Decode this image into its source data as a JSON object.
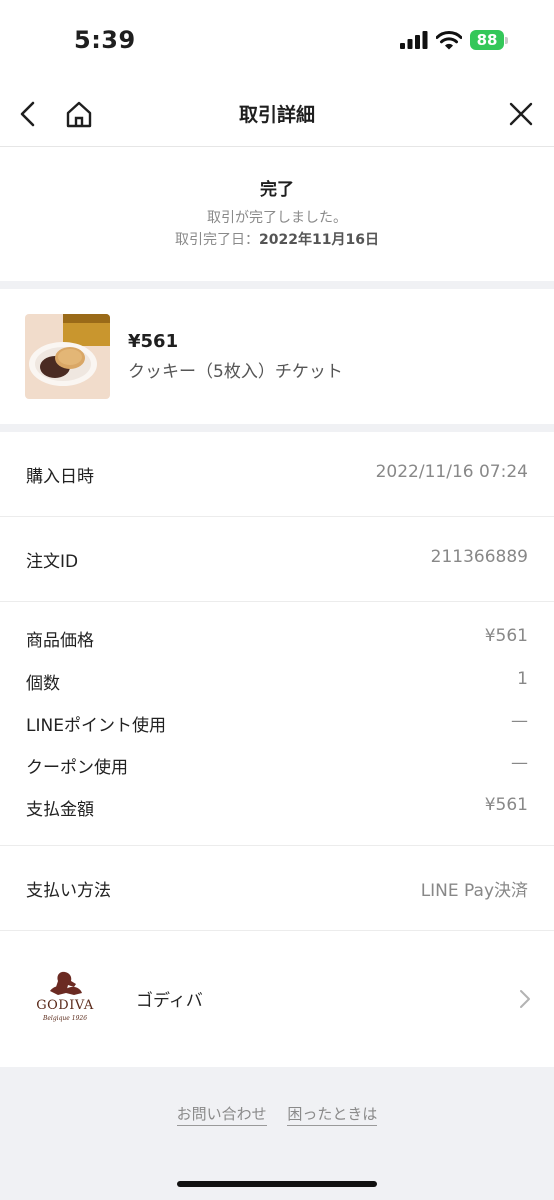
{
  "status_bar": {
    "time": "5:39",
    "battery": "88"
  },
  "nav": {
    "title": "取引詳細"
  },
  "transaction": {
    "status_title": "完了",
    "status_message": "取引が完了しました。",
    "completion_date_label": "取引完了日：",
    "completion_date_value": "2022年11月16日"
  },
  "product": {
    "price": "¥561",
    "name": "クッキー（5枚入）チケット"
  },
  "details": {
    "purchase_datetime_label": "購入日時",
    "purchase_datetime_value": "2022/11/16 07:24",
    "order_id_label": "注文ID",
    "order_id_value": "211366889",
    "price_rows": [
      {
        "label": "商品価格",
        "value": "¥561"
      },
      {
        "label": "個数",
        "value": "1"
      },
      {
        "label": "LINEポイント使用",
        "value": "—"
      },
      {
        "label": "クーポン使用",
        "value": "—"
      },
      {
        "label": "支払金額",
        "value": "¥561"
      }
    ],
    "payment_method_label": "支払い方法",
    "payment_method_value": "LINE Pay決済"
  },
  "shop": {
    "name": "ゴディバ",
    "logo_text": "GODIVA",
    "logo_subtext": "Belgique 1926"
  },
  "footer": {
    "contact_label": "お問い合わせ",
    "help_label": "困ったときは"
  }
}
